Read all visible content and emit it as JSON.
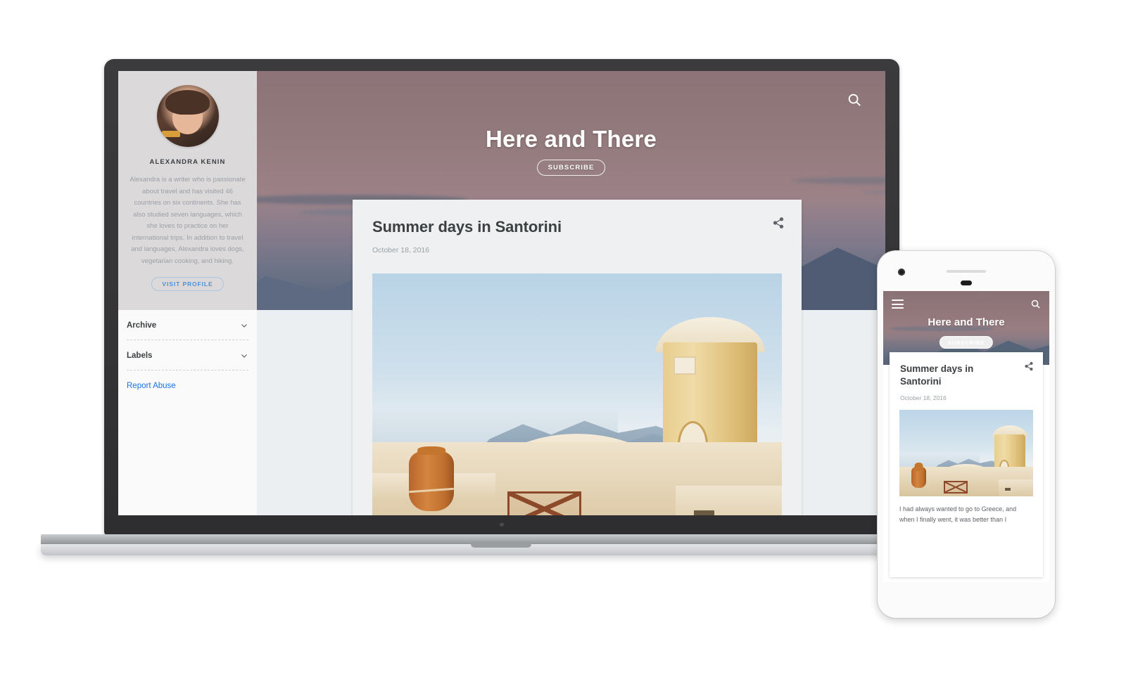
{
  "blog": {
    "title": "Here and There",
    "subscribe_label": "SUBSCRIBE",
    "search_icon": "search-icon"
  },
  "sidebar": {
    "author_name": "ALEXANDRA KENIN",
    "author_bio": "Alexandra is a writer who is passionate about travel and has visited 46 countries on six continents. She has also studied seven languages, which she loves to practice on her international trips. In addition to travel and languages, Alexandra loves dogs, vegetarian cooking, and hiking.",
    "visit_profile_label": "VISIT PROFILE",
    "nav": [
      {
        "label": "Archive",
        "icon": "chevron-down-icon"
      },
      {
        "label": "Labels",
        "icon": "chevron-down-icon"
      }
    ],
    "report_abuse_label": "Report Abuse",
    "link_color": "#1a73e8"
  },
  "post": {
    "title": "Summer days in Santorini",
    "date": "October 18, 2016",
    "share_icon": "share-icon",
    "photo_alt": "Santorini rooftop with terracotta urn and round tower"
  },
  "phone": {
    "menu_icon": "hamburger-menu-icon",
    "search_icon": "search-icon",
    "title": "Here and There",
    "subscribe_label": "SUBSCRIBE",
    "post_title": "Summer days in Santorini",
    "post_date": "October 18, 2016",
    "share_icon": "share-icon",
    "body_text": "I had always wanted to go to Greece, and when I finally went, it was better than I"
  }
}
